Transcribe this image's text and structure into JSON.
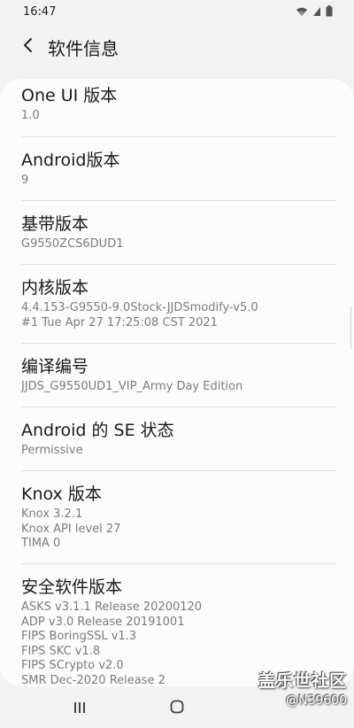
{
  "status_bar": {
    "time": "16:47"
  },
  "header": {
    "title": "软件信息"
  },
  "items": [
    {
      "title": "One UI 版本",
      "values": [
        "1.0"
      ]
    },
    {
      "title": "Android版本",
      "values": [
        "9"
      ]
    },
    {
      "title": "基带版本",
      "values": [
        "G9550ZCS6DUD1"
      ]
    },
    {
      "title": "内核版本",
      "values": [
        "4.4.153-G9550-9.0Stock-JJDSmodify-v5.0",
        "#1 Tue Apr 27 17:25:08 CST 2021"
      ]
    },
    {
      "title": "编译编号",
      "values": [
        "JJDS_G9550UD1_VIP_Army Day Edition"
      ]
    },
    {
      "title": "Android 的 SE 状态",
      "values": [
        "Permissive"
      ]
    },
    {
      "title": "Knox 版本",
      "values": [
        "Knox 3.2.1",
        "Knox API level 27",
        "TIMA 0"
      ]
    },
    {
      "title": "安全软件版本",
      "values": [
        "ASKS v3.1.1 Release 20200120",
        "ADP v3.0 Release 20191001",
        "FIPS BoringSSL v1.3",
        "FIPS SKC v1.8",
        "FIPS SCrypto v2.0",
        "SMR Dec-2020 Release 2"
      ]
    }
  ],
  "watermark": {
    "logo": "盖乐世社区",
    "user": "@N39600"
  },
  "colors": {
    "background": "#f2f2f2",
    "card": "#fcfcfc",
    "title_text": "#1a1a1a",
    "value_text": "#7b7b7b",
    "divider": "#dedede"
  },
  "icons": {
    "wifi": "wifi-icon",
    "signal": "signal-icon",
    "battery": "battery-icon",
    "back": "back-arrow-icon",
    "recents": "recents-icon",
    "home": "home-icon"
  }
}
